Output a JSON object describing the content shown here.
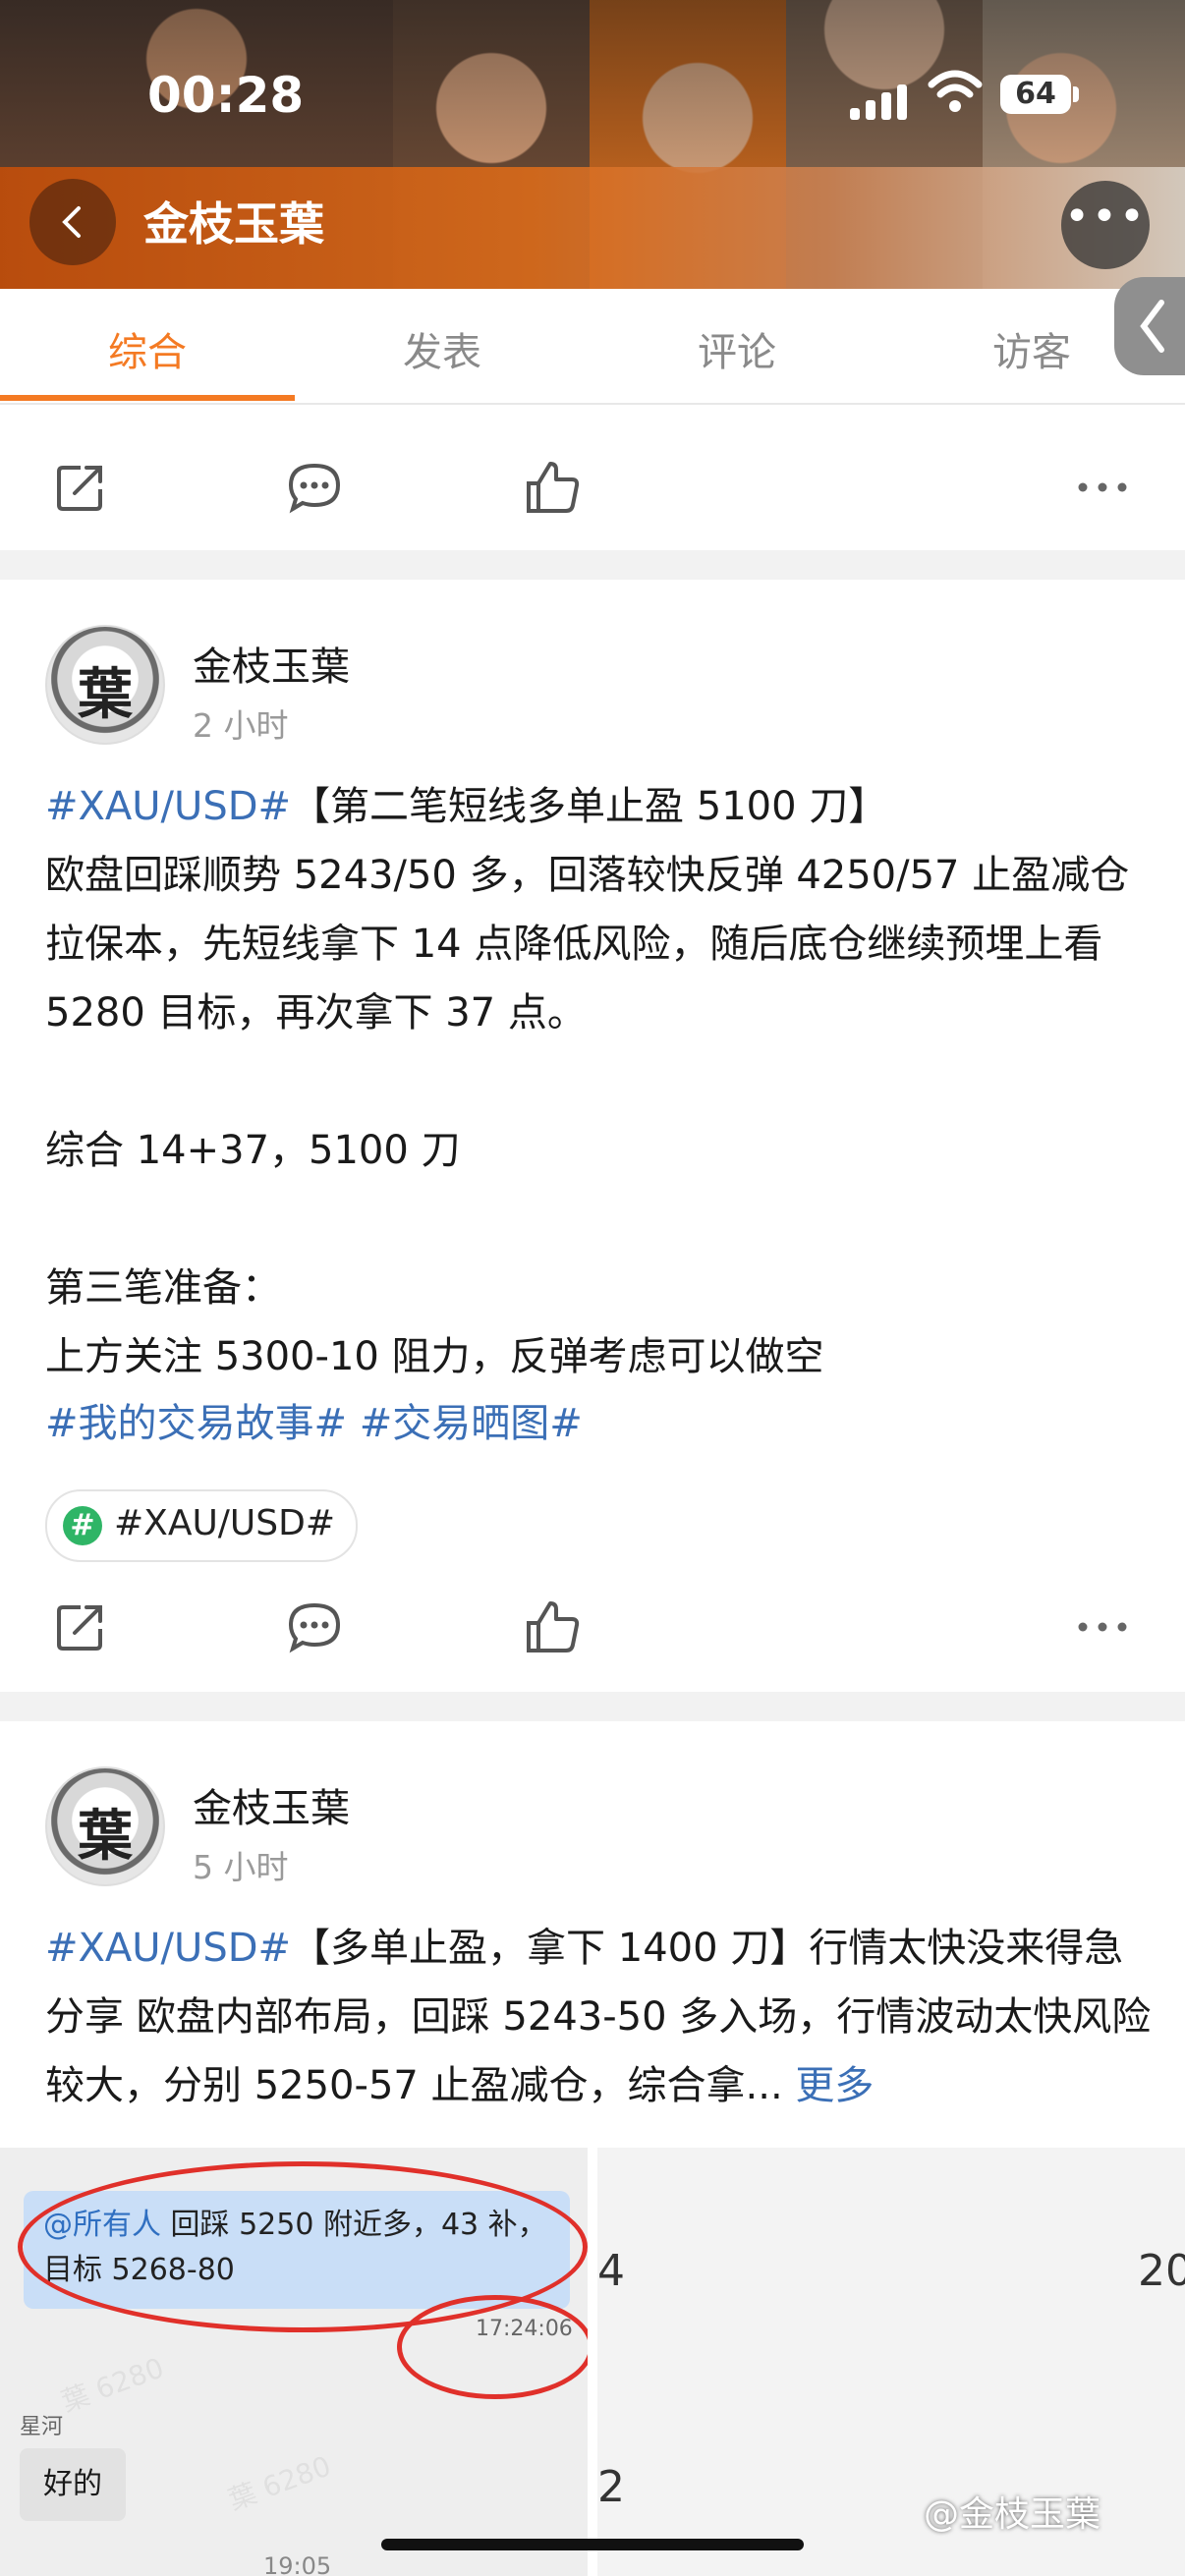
{
  "status_bar": {
    "time": "00:28",
    "battery": "64"
  },
  "header": {
    "title": "金枝玉葉"
  },
  "tabs": [
    {
      "label": "综合",
      "active": true
    },
    {
      "label": "发表",
      "active": false
    },
    {
      "label": "评论",
      "active": false
    },
    {
      "label": "访客",
      "active": false
    }
  ],
  "posts": [
    {
      "author": "金枝玉葉",
      "time": "2 小时",
      "hashtag_head": "#XAU/USD#",
      "headline": "【第二笔短线多单止盈 5100 刀】",
      "body": "欧盘回踩顺势 5243/50 多，回落较快反弹 4250/57 止盈减仓拉保本，先短线拿下 14 点降低风险，随后底仓继续预埋上看 5280 目标，再次拿下 37 点。\n\n综合 14+37，5100 刀\n\n第三笔准备：\n上方关注 5300-10 阻力，反弹考虑可以做空",
      "tags": "#我的交易故事# #交易晒图#",
      "topic": "#XAU/USD#"
    },
    {
      "author": "金枝玉葉",
      "time": "5 小时",
      "hashtag_head": "#XAU/USD#",
      "body": "【多单止盈，拿下 1400 刀】行情太快没来得急分享 欧盘内部布局，回踩 5243-50 多入场，行情波动太快风险较大，分别 5250-57 止盈减仓，综合拿...",
      "more": "更多"
    }
  ],
  "chat_image": {
    "mention": "@所有人",
    "message": " 回踩 5250 附近多，43 补，目标 5268-80",
    "time": "17:24:06",
    "sender": "星河",
    "reply": "好的",
    "time2": "19:05",
    "watermark": "葉 6280",
    "right_nums": [
      "4",
      "20",
      "2"
    ]
  },
  "credit": "@金枝玉葉"
}
